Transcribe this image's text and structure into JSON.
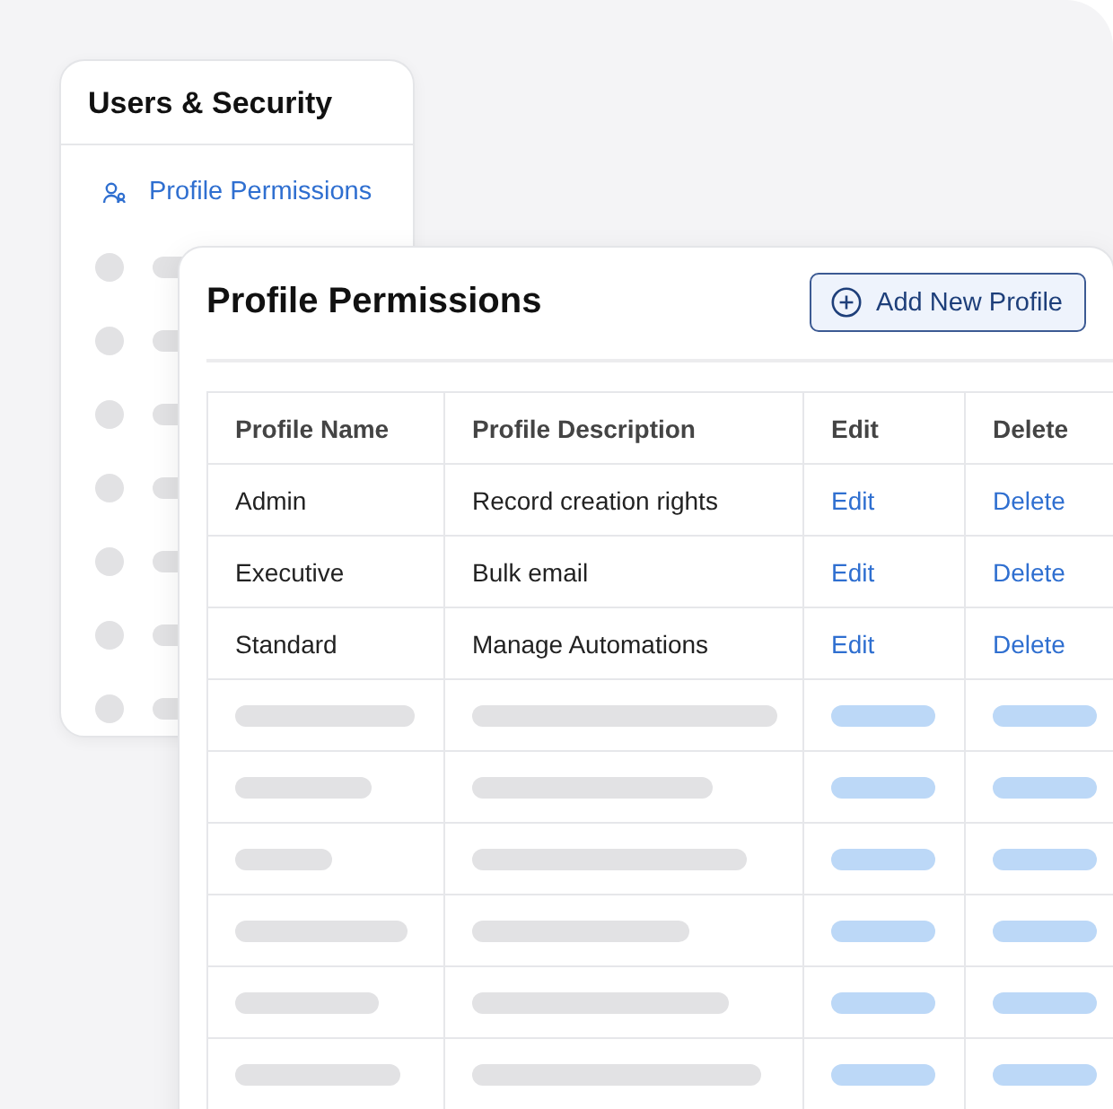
{
  "sidebar": {
    "title": "Users & Security",
    "items": [
      {
        "label": "Profile Permissions",
        "selected": true
      }
    ]
  },
  "panel": {
    "title": "Profile Permissions",
    "button": "Add New Profile",
    "table": {
      "columns": [
        "Profile Name",
        "Profile Description",
        "Edit",
        "Delete"
      ],
      "rows": [
        {
          "name": "Admin",
          "description": "Record creation rights",
          "edit": "Edit",
          "delete": "Delete"
        },
        {
          "name": "Executive",
          "description": "Bulk email",
          "edit": "Edit",
          "delete": "Delete"
        },
        {
          "name": "Standard",
          "description": "Manage Automations",
          "edit": "Edit",
          "delete": "Delete"
        }
      ]
    }
  }
}
